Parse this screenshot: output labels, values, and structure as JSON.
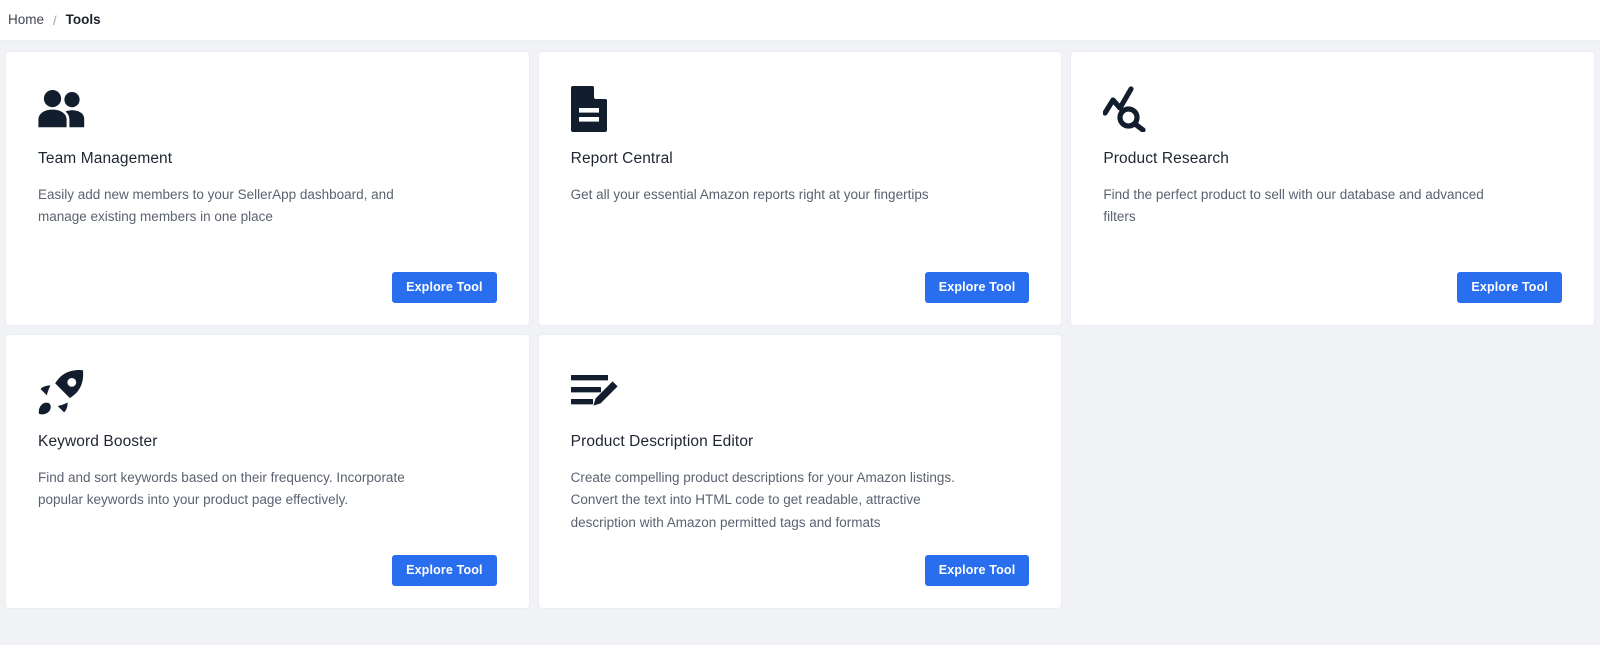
{
  "breadcrumb": {
    "home_label": "Home",
    "separator": "/",
    "current_label": "Tools"
  },
  "theme": {
    "accent": "#2a6ef0",
    "page_background": "#f1f2f6",
    "card_background": "#ffffff",
    "icon_color": "#121d2e",
    "title_color": "#1f2632",
    "description_color": "#5b6270"
  },
  "tools": [
    {
      "icon": "people-group-icon",
      "title": "Team Management",
      "description": "Easily add new members to your SellerApp dashboard, and manage existing members in one place",
      "button_label": "Explore Tool"
    },
    {
      "icon": "document-report-icon",
      "title": "Report Central",
      "description": "Get all your essential Amazon reports right at your fingertips",
      "button_label": "Explore Tool"
    },
    {
      "icon": "trend-search-icon",
      "title": "Product Research",
      "description": "Find the perfect product to sell with our database and advanced filters",
      "button_label": "Explore Tool"
    },
    {
      "icon": "rocket-icon",
      "title": "Keyword Booster",
      "description": "Find and sort keywords based on their frequency. Incorporate popular keywords into your product page effectively.",
      "button_label": "Explore Tool"
    },
    {
      "icon": "list-edit-pencil-icon",
      "title": "Product Description Editor",
      "description": "Create compelling product descriptions for your Amazon listings. Convert the text into HTML code to get readable, attractive description with Amazon permitted tags and formats",
      "button_label": "Explore Tool"
    }
  ]
}
